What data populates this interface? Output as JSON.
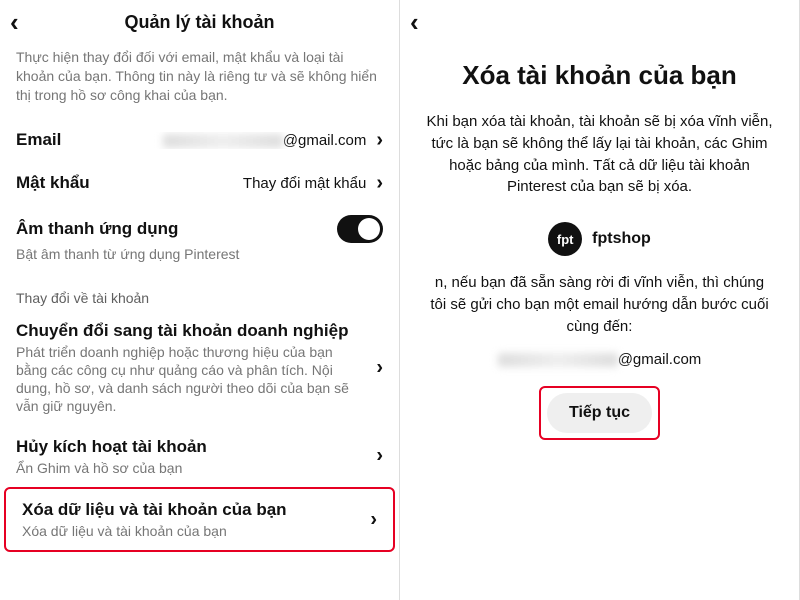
{
  "left": {
    "header_title": "Quản lý tài khoản",
    "intro": "Thực hiện thay đổi đối với email, mật khẩu và loại tài khoản của bạn. Thông tin này là riêng tư và sẽ không hiển thị trong hồ sơ công khai của bạn.",
    "email": {
      "label": "Email",
      "domain_suffix": "@gmail.com"
    },
    "password": {
      "label": "Mật khẩu",
      "action": "Thay đổi mật khẩu"
    },
    "sound": {
      "label": "Âm thanh ứng dụng",
      "desc": "Bật âm thanh từ ứng dụng Pinterest",
      "on": true
    },
    "section_title": "Thay đổi về tài khoản",
    "convert": {
      "title": "Chuyển đổi sang tài khoản doanh nghiệp",
      "desc": "Phát triển doanh nghiệp hoặc thương hiệu của bạn bằng các công cụ như quảng cáo và phân tích. Nội dung, hồ sơ, và danh sách người theo dõi của bạn sẽ vẫn giữ nguyên."
    },
    "deactivate": {
      "title": "Hủy kích hoạt tài khoản",
      "desc": "Ẩn Ghim và hồ sơ của bạn"
    },
    "delete": {
      "title": "Xóa dữ liệu và tài khoản của bạn",
      "desc": "Xóa dữ liệu và tài khoản của bạn"
    }
  },
  "right": {
    "title": "Xóa tài khoản của bạn",
    "body": "Khi bạn xóa tài khoản, tài khoản sẽ bị xóa vĩnh viễn, tức là bạn sẽ không thể lấy lại tài khoản, các Ghim hoặc bảng của mình. Tất cả dữ liệu tài khoản Pinterest của bạn sẽ bị xóa.",
    "avatar_label": "fpt",
    "username": "fptshop",
    "body2": "n, nếu bạn đã sẵn sàng rời đi vĩnh viễn, thì chúng tôi sẽ gửi cho bạn một email hướng dẫn bước cuối cùng đến:",
    "email_suffix": "@gmail.com",
    "continue_label": "Tiếp tục"
  }
}
